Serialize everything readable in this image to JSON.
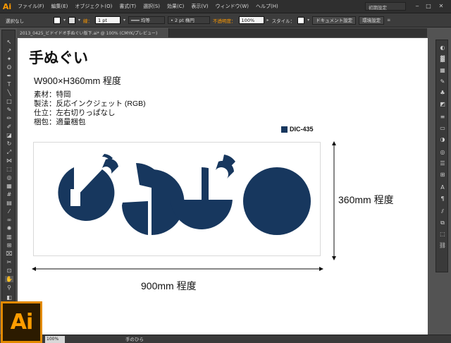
{
  "app": {
    "logo_small": "Ai",
    "logo_large": "Ai"
  },
  "menu": [
    "ファイル(F)",
    "編集(E)",
    "オブジェクト(O)",
    "書式(T)",
    "選択(S)",
    "効果(C)",
    "表示(V)",
    "ウィンドウ(W)",
    "ヘルプ(H)"
  ],
  "workspace": {
    "label": "初期設定"
  },
  "control_bar": {
    "selection": "選択なし",
    "stroke_label": "線：",
    "stroke_weight": "1 pt",
    "stroke_profile": "均等",
    "brush": "2 pt 楕円",
    "opacity_label": "不透明度：",
    "opacity_value": "100%",
    "style_label": "スタイル：",
    "doc_settings": "ドキュメント設定",
    "preferences": "環境設定"
  },
  "document_tab": {
    "title": "2013_0425_ビドイドオ手ぬぐい版下.ai* @ 100% (CMYK/プレビュー)"
  },
  "status_bar": {
    "zoom": "100%",
    "tool": "手のひら"
  },
  "document": {
    "title": "手ぬぐい",
    "size": "W900×H360mm 程度",
    "specs": [
      "素材：特岡",
      "製法：反応インクジェット (RGB)",
      "仕立：左右切りっぱなし",
      "梱包：適量梱包"
    ],
    "color": {
      "name": "DIC-435",
      "hex": "#17375e"
    },
    "height_dimension": "360mm 程度",
    "width_dimension": "900mm 程度"
  }
}
